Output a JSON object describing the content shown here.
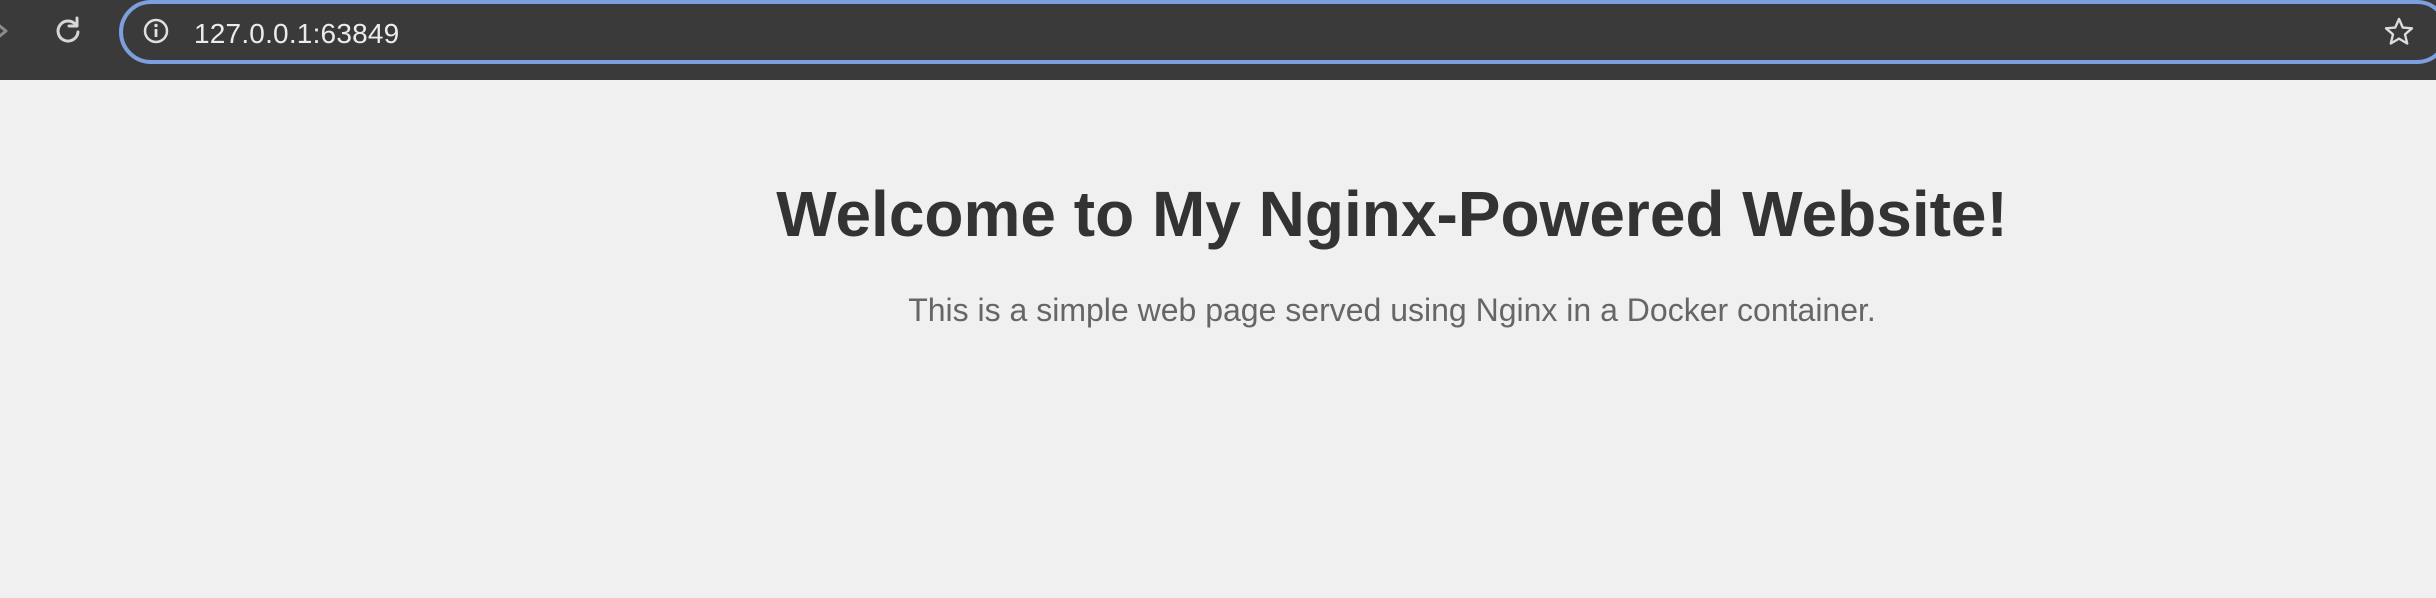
{
  "browser": {
    "address_bar": {
      "url": "127.0.0.1:63849"
    },
    "icons": {
      "forward": "forward-arrow-icon",
      "reload": "reload-icon",
      "site_info": "info-icon",
      "bookmark": "star-icon"
    }
  },
  "page": {
    "heading": "Welcome to My Nginx-Powered Website!",
    "paragraph": "This is a simple web page served using Nginx in a Docker container."
  },
  "colors": {
    "toolbar_bg": "#3a3a3a",
    "omnibox_focus_border": "#7c9fe0",
    "page_bg": "#f0f0f0",
    "heading_text": "#333333",
    "paragraph_text": "#666666"
  }
}
